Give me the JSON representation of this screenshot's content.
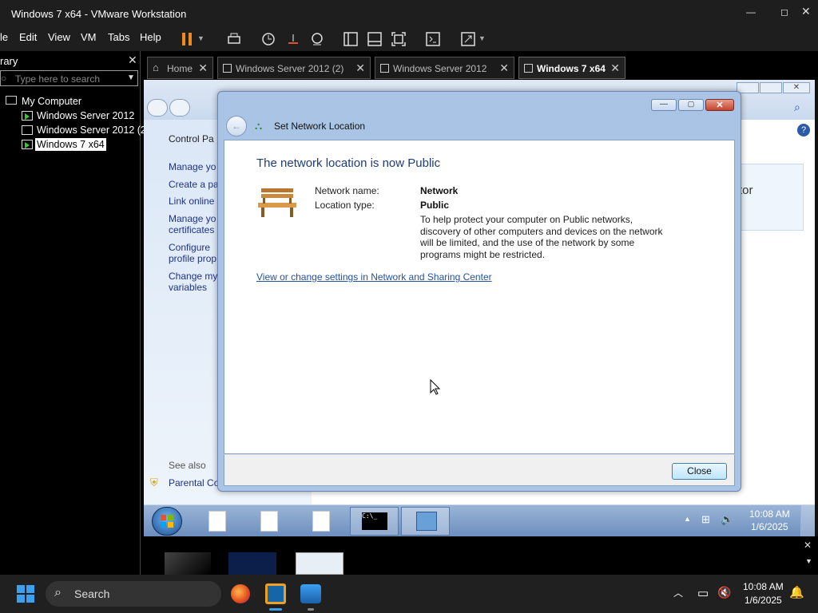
{
  "window": {
    "title": "Windows 7 x64 - VMware Workstation"
  },
  "menu": [
    "le",
    "Edit",
    "View",
    "VM",
    "Tabs",
    "Help"
  ],
  "library": {
    "title": "rary",
    "search_placeholder": "Type here to search",
    "root": "My Computer",
    "items": [
      "Windows Server 2012",
      "Windows Server 2012 (2)",
      "Windows 7 x64"
    ]
  },
  "tabs": [
    {
      "label": "Home"
    },
    {
      "label": "Windows Server 2012 (2)"
    },
    {
      "label": "Windows Server 2012"
    },
    {
      "label": "Windows 7 x64"
    }
  ],
  "control_panel": {
    "links": [
      "Control Pa",
      "Manage yo",
      "Create a pa",
      "Link online",
      "Manage yo\ncertificates",
      "Configure\nprofile prop",
      "Change my\nvariables"
    ],
    "see_also": "See also",
    "parental": "Parental Co",
    "right_text": "tor"
  },
  "dialog": {
    "title": "Set Network Location",
    "heading": "The network location is now Public",
    "name_label": "Network name:",
    "name_value": "Network",
    "type_label": "Location type:",
    "type_value": "Public",
    "description": "To help protect your computer on Public networks, discovery of other computers and devices on the network will be limited, and the use of the network by some programs might be restricted.",
    "link": "View or change settings in Network and Sharing Center",
    "close_button": "Close"
  },
  "guest_tray": {
    "time": "10:08 AM",
    "date": "1/6/2025"
  },
  "host_taskbar": {
    "search": "Search",
    "time": "10:08 AM",
    "date": "1/6/2025"
  },
  "colors": {
    "accent": "#1e5bb8",
    "pause": "#f08a1c"
  }
}
